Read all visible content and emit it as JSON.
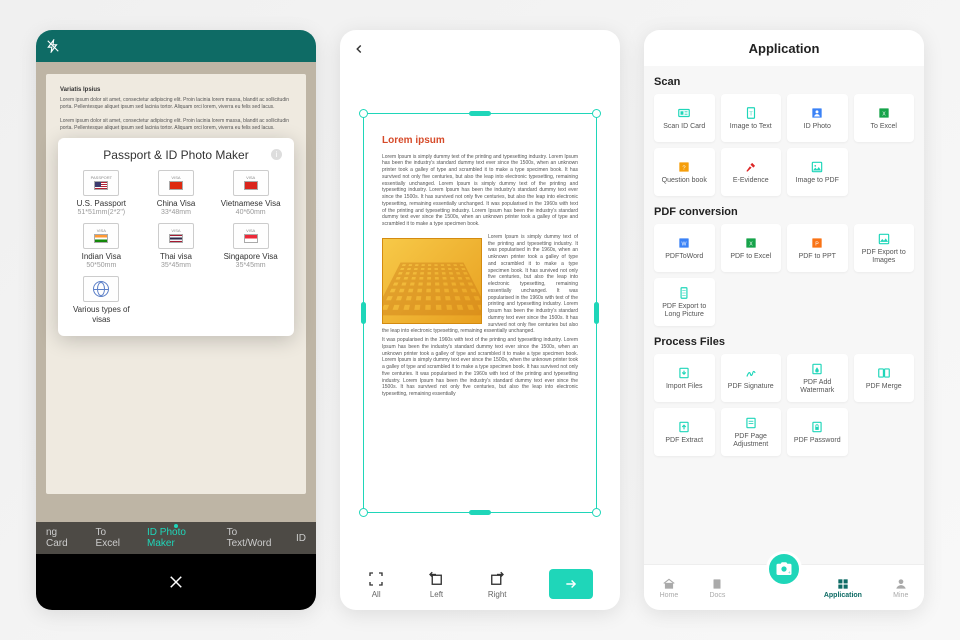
{
  "screen1": {
    "modal_title": "Passport & ID Photo Maker",
    "visas": [
      {
        "name": "U.S. Passport",
        "dim": "51*51mm(2*2\")",
        "flag": "us",
        "tag": "PASSPORT"
      },
      {
        "name": "China Visa",
        "dim": "33*48mm",
        "flag": "cn",
        "tag": "VISA"
      },
      {
        "name": "Vietnamese Visa",
        "dim": "40*60mm",
        "flag": "vn",
        "tag": "VISA"
      },
      {
        "name": "Indian Visa",
        "dim": "50*50mm",
        "flag": "in",
        "tag": "VISA"
      },
      {
        "name": "Thai visa",
        "dim": "35*45mm",
        "flag": "th",
        "tag": "VISA"
      },
      {
        "name": "Singapore Visa",
        "dim": "35*45mm",
        "flag": "sg",
        "tag": "VISA"
      },
      {
        "name": "Various types of visas",
        "dim": "",
        "flag": "globe",
        "tag": ""
      }
    ],
    "tabs": [
      "ng Card",
      "To Excel",
      "ID Photo Maker",
      "To Text/Word",
      "ID"
    ],
    "active_tab": 2,
    "doc_title": "Variatis Ipsius",
    "doc_text": "Lorem ipsum dolor sit amet, consectetur adipiscing elit. Proin lacinia lorem massa, blandit ac sollicitudin porta. Pellentesque aliquet ipsum sed lacinia tortor. Aliquam orci lorem, viverra eu felis sed lacus."
  },
  "screen2": {
    "page_title": "Lorem ipsum",
    "page_text": "Lorem Ipsum is simply dummy text of the printing and typesetting industry. Lorem Ipsum has been the industry's standard dummy text ever since the 1500s, when an unknown printer took a galley of type and scrambled it to make a type specimen book. It has survived not only five centuries, but also the leap into electronic typesetting, remaining essentially unchanged. Lorem Ipsum is simply dummy text of the printing and typesetting industry. Lorem Ipsum has been the industry's standard dummy text ever since the 1500s. It has survived not only five centuries, but also the leap into electronic typesetting, remaining essentially unchanged. It was popularised in the 1960s with text of the printing and typesetting industry. Lorem Ipsum has been the industry's standard dummy text ever since the 1500s, when an unknown printer took a galley of type and scrambled it to make a type specimen book.",
    "wrap_text": "Lorem Ipsum is simply dummy text of the printing and typesetting industry. It was popularised in the 1960s, when an unknown printer took a galley of type and scrambled it to make a type specimen book. It has survived not only five centuries, but also the leap into electronic typesetting, remaining essentially unchanged. It was popularised in the 1960s with text of the printing and typesetting industry. Lorem Ipsum has been the industry's standard dummy text ever since the 1500s. It has survived not only five centuries but also the leap into electronic typesetting, remaining essentially unchanged.",
    "after_text": "It was popularised in the 1960s with text of the printing and typesetting industry. Lorem Ipsum has been the industry's standard dummy text ever since the 1500s, when an unknown printer took a galley of type and scrambled it to make a type specimen book. Lorem Ipsum is simply dummy text ever since the 1500s, when the unknown printer took a galley of type and scrambled it to make a type specimen book. It has survived not only five centuries. It was popularised in the 1960s with text of the printing and typesetting industry. Lorem Ipsum has been the industry's standard dummy text ever since the 1500s. It has survived not only five centuries, but also the leap into electronic typesetting, remaining essentially",
    "tools": [
      {
        "label": "All",
        "icon": "crop-all"
      },
      {
        "label": "Left",
        "icon": "rotate-left"
      },
      {
        "label": "Right",
        "icon": "rotate-right"
      }
    ]
  },
  "screen3": {
    "header": "Application",
    "sections": [
      {
        "title": "Scan",
        "items": [
          {
            "label": "Scan ID Card",
            "color": "#1fd6b9",
            "icon": "id"
          },
          {
            "label": "Image to Text",
            "color": "#1fd6b9",
            "icon": "text"
          },
          {
            "label": "ID Photo",
            "color": "#3b82f6",
            "icon": "photo"
          },
          {
            "label": "To Excel",
            "color": "#16a34a",
            "icon": "excel"
          },
          {
            "label": "Question book",
            "color": "#f59e0b",
            "icon": "book"
          },
          {
            "label": "E-Evidence",
            "color": "#dc2626",
            "icon": "gavel"
          },
          {
            "label": "Image to PDF",
            "color": "#1fd6b9",
            "icon": "imgpdf"
          }
        ]
      },
      {
        "title": "PDF conversion",
        "items": [
          {
            "label": "PDFToWord",
            "color": "#3b82f6",
            "icon": "word"
          },
          {
            "label": "PDF to Excel",
            "color": "#16a34a",
            "icon": "excel2"
          },
          {
            "label": "PDF to PPT",
            "color": "#f97316",
            "icon": "ppt"
          },
          {
            "label": "PDF Export to Images",
            "color": "#1fd6b9",
            "icon": "img"
          },
          {
            "label": "PDF Export to Long Picture",
            "color": "#1fd6b9",
            "icon": "long"
          }
        ]
      },
      {
        "title": "Process Files",
        "items": [
          {
            "label": "Import Files",
            "color": "#1fd6b9",
            "icon": "import"
          },
          {
            "label": "PDF Signature",
            "color": "#1fd6b9",
            "icon": "sig"
          },
          {
            "label": "PDF Add Watermark",
            "color": "#1fd6b9",
            "icon": "water"
          },
          {
            "label": "PDF Merge",
            "color": "#1fd6b9",
            "icon": "merge"
          },
          {
            "label": "PDF Extract",
            "color": "#1fd6b9",
            "icon": "extract"
          },
          {
            "label": "PDF Page Adjustment",
            "color": "#1fd6b9",
            "icon": "page"
          },
          {
            "label": "PDF Password",
            "color": "#1fd6b9",
            "icon": "lock"
          }
        ]
      }
    ],
    "nav": [
      {
        "label": "Home",
        "icon": "home"
      },
      {
        "label": "Docs",
        "icon": "docs"
      },
      {
        "label": "Application",
        "icon": "app",
        "active": true
      },
      {
        "label": "Mine",
        "icon": "mine"
      }
    ]
  }
}
